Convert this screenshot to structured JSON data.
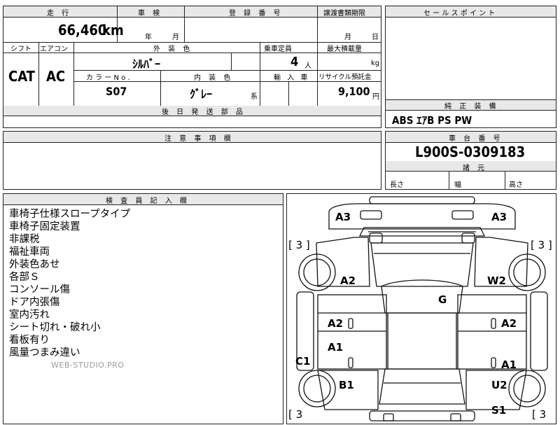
{
  "headers": {
    "mileage": "走 行",
    "inspection": "車 検",
    "registration": "登 録 番 号",
    "transfer_deadline": "譲渡書類期限",
    "sales_points": "セ ー ル ス ポ イ ン ト",
    "shift": "シフト",
    "aircon": "エアコン",
    "exterior_color": "外 装 色",
    "capacity": "乗車定員",
    "max_load": "最大積載量",
    "color_no": "カ ラ ー N o .",
    "interior_color": "内 装 色",
    "import": "輸 入 車",
    "recycle_fee": "リサイクル預託金",
    "later_parts": "後 日 発 送 部 品",
    "standard_equipment": "純 正 装 備",
    "caution": "注 意 事 項 欄",
    "chassis_number": "車 台 番 号",
    "dimensions": "諸 元",
    "inspector_notes": "検 査 員 記 入 欄"
  },
  "values": {
    "mileage": "66,460",
    "mileage_unit": "km",
    "year_label": "年",
    "month_label": "月",
    "transfer_month": "月",
    "transfer_day": "日",
    "shift": "CAT",
    "aircon": "AC",
    "exterior_color": "ｼﾙﾊﾞｰ",
    "capacity": "4",
    "capacity_unit": "人",
    "load_unit": "kg",
    "color_no": "S07",
    "interior_color": "ｸﾞﾚｰ",
    "interior_suffix": "系",
    "recycle_fee": "9,100",
    "recycle_unit": "円",
    "standard_equipment": "ABS ｴｱB PS PW",
    "chassis_number": "L900S-0309183",
    "length_label": "長さ",
    "width_label": "幅",
    "height_label": "高さ"
  },
  "notes": [
    "車椅子仕様スロープタイプ",
    "車椅子固定装置",
    "非課税",
    "福祉車両",
    "外装色あせ",
    "各部Ｓ",
    "コンソール傷",
    "ドア内張傷",
    "室内汚れ",
    "シート切れ・破れ小",
    "看板有り",
    "風量つまみ違い"
  ],
  "watermark": "WEB-STUDIO.PRO",
  "diagram": {
    "markers": {
      "a3_left": "A3",
      "a3_right": "A3",
      "bracket_tl": "[ 3 ]",
      "bracket_tr": "[ 3 ]",
      "a2_left_front": "A2",
      "w2_right": "W2",
      "g_center": "G",
      "a2_left_door": "A2",
      "a2_right_door": "A2",
      "a1_left_door": "A1",
      "c1_left": "C1",
      "a1_right_door": "A1",
      "b1_left": "B1",
      "u2_right": "U2",
      "s1_right": "S1",
      "bracket_bl": "[ 3",
      "bracket_br": "[ 3"
    }
  }
}
